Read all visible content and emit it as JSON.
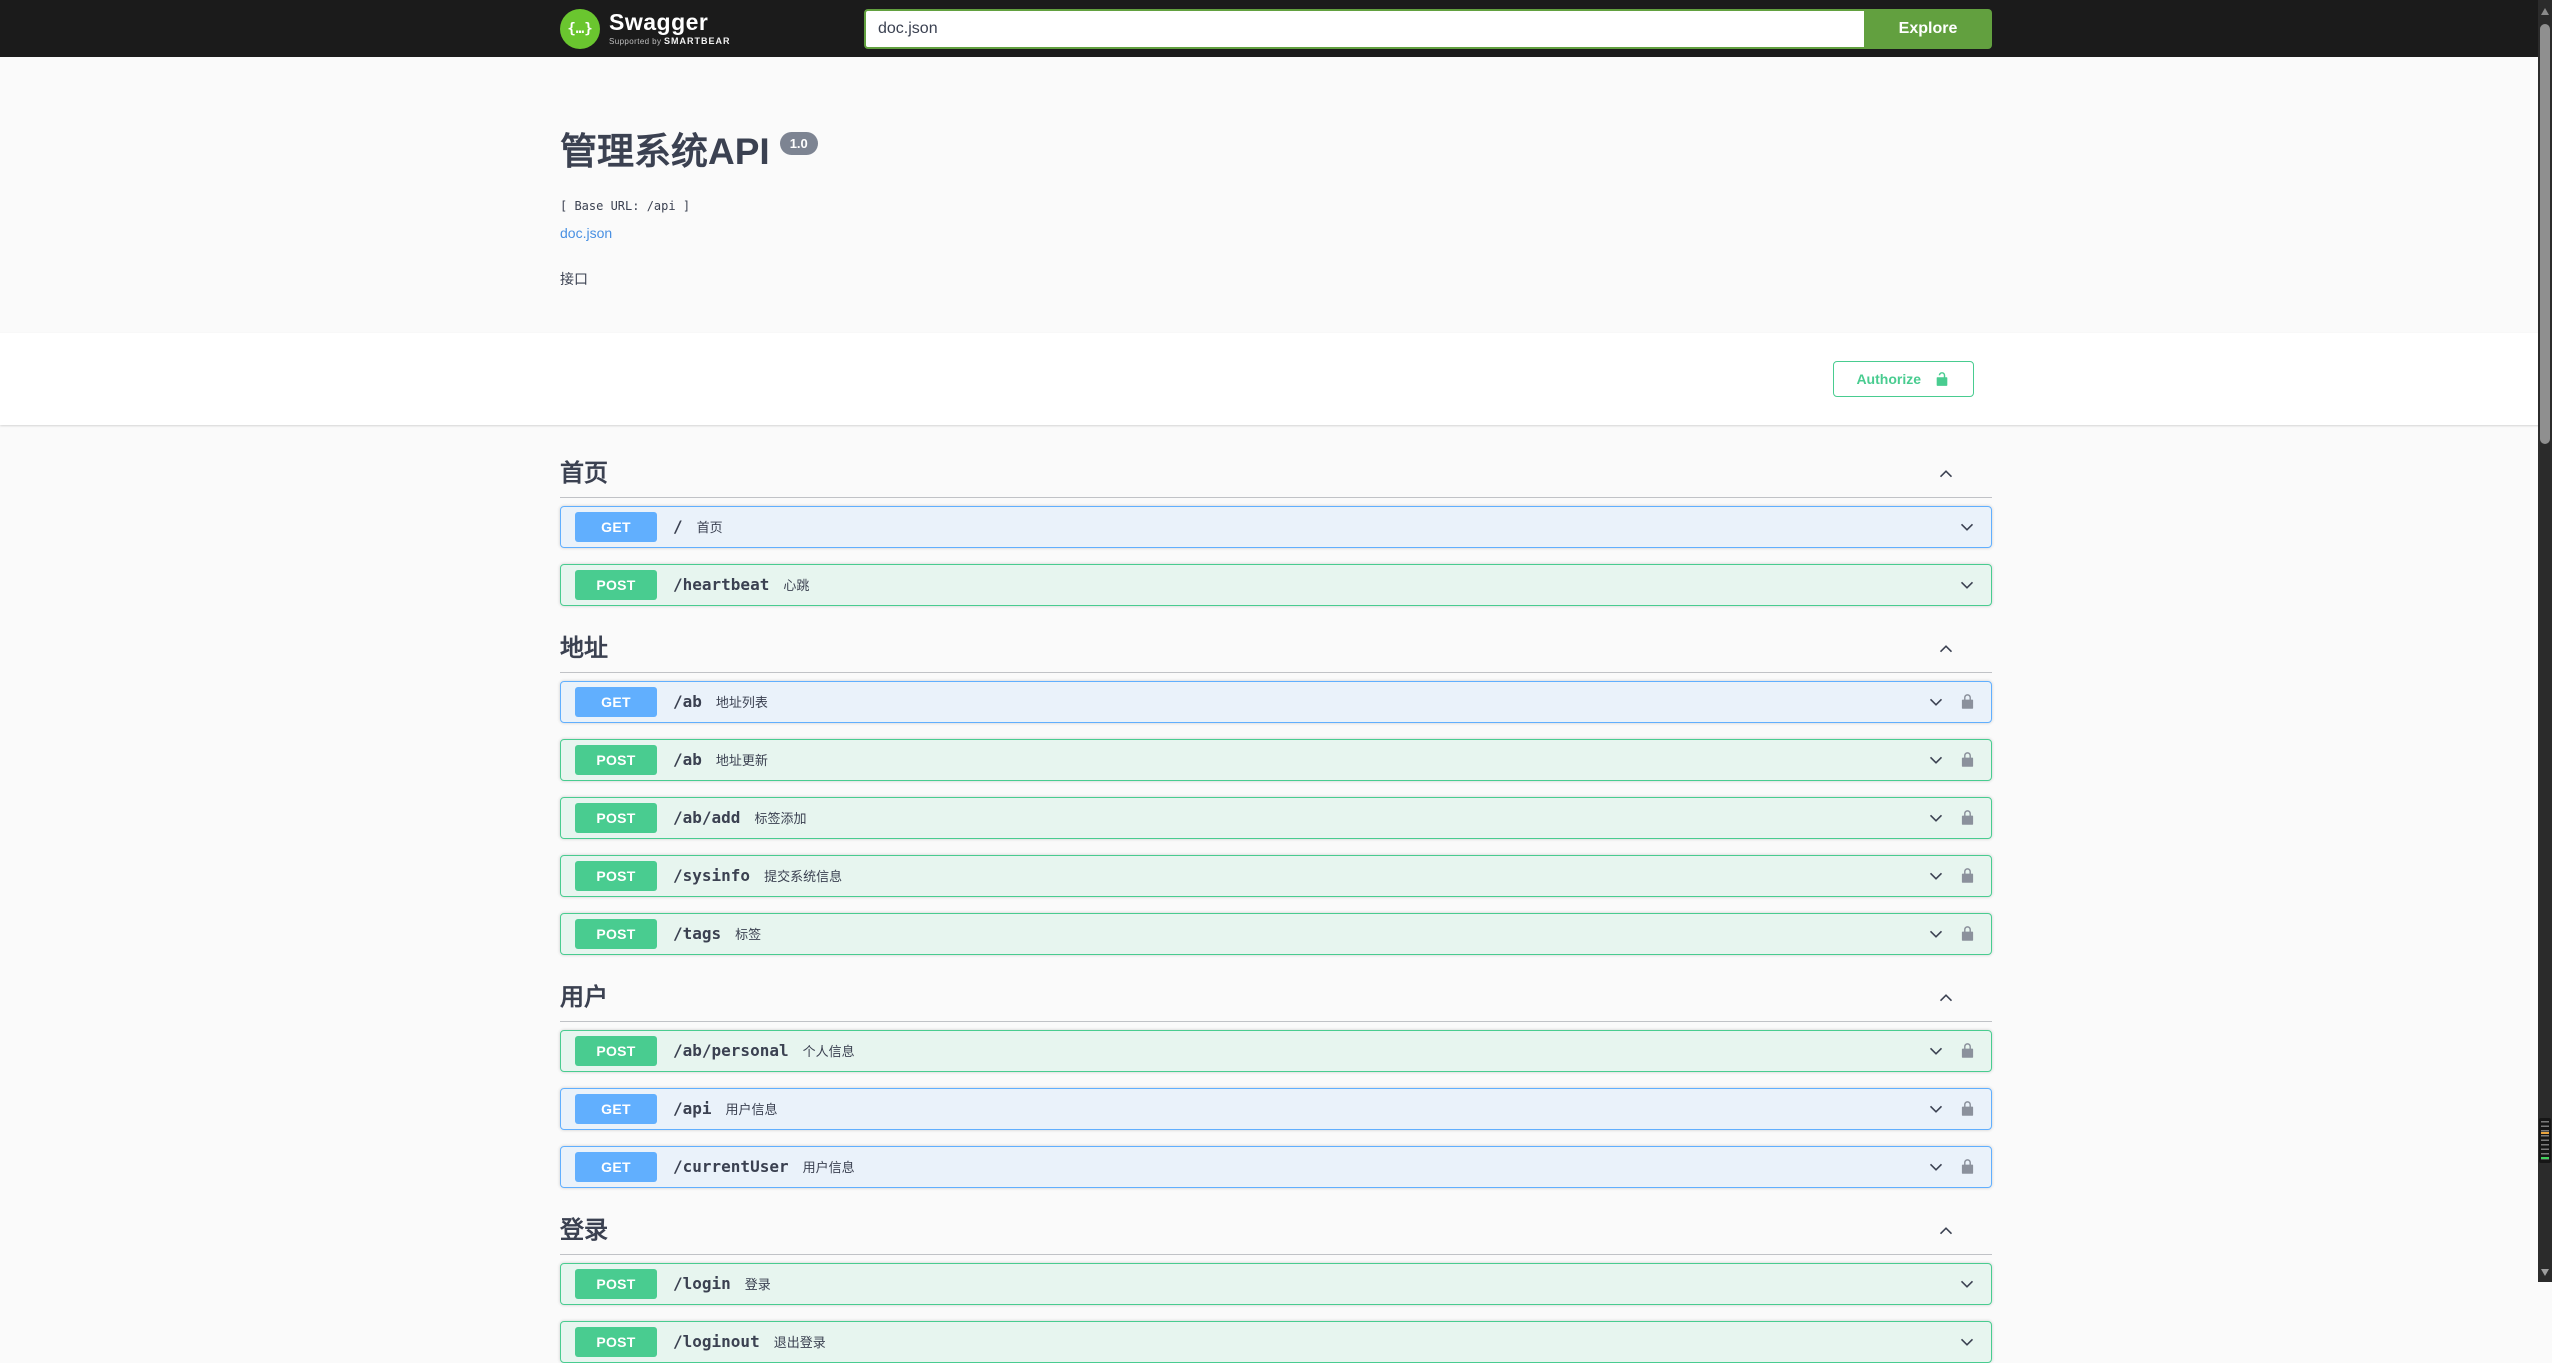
{
  "topbar": {
    "logo_text": "Swagger",
    "tagline_prefix": "Supported by",
    "tagline_brand": "SMARTBEAR",
    "search_value": "doc.json",
    "explore_label": "Explore"
  },
  "info": {
    "title": "管理系统API",
    "version_badge": "1.0",
    "base_url_line": "[ Base URL: /api ]",
    "spec_link": "doc.json",
    "description": "接口"
  },
  "auth": {
    "authorize_label": "Authorize"
  },
  "colors": {
    "topbar_bg": "#1b1b1b",
    "topbar_green": "#62a03f",
    "logo_green": "#6ac62f",
    "get_blue": "#61affe",
    "post_green": "#49cc90",
    "text": "#3b4151",
    "link_blue": "#4990e2",
    "version_badge_bg": "#7d8492",
    "lock_gray": "#8b919c",
    "scroll_marker_orange": "#e8a33d",
    "scroll_marker_green": "#43d05e"
  },
  "icons": [
    "swagger-logo",
    "search-input",
    "explore-button",
    "unlock-icon",
    "chevron-up-icon",
    "chevron-down-icon",
    "lock-icon",
    "scroll-up-icon",
    "scroll-down-icon"
  ],
  "sections": [
    {
      "name": "首页",
      "expanded": true,
      "operations": [
        {
          "method": "GET",
          "path": "/",
          "summary": "首页",
          "locked": false
        },
        {
          "method": "POST",
          "path": "/heartbeat",
          "summary": "心跳",
          "locked": false
        }
      ]
    },
    {
      "name": "地址",
      "expanded": true,
      "operations": [
        {
          "method": "GET",
          "path": "/ab",
          "summary": "地址列表",
          "locked": true
        },
        {
          "method": "POST",
          "path": "/ab",
          "summary": "地址更新",
          "locked": true
        },
        {
          "method": "POST",
          "path": "/ab/add",
          "summary": "标签添加",
          "locked": true
        },
        {
          "method": "POST",
          "path": "/sysinfo",
          "summary": "提交系统信息",
          "locked": true
        },
        {
          "method": "POST",
          "path": "/tags",
          "summary": "标签",
          "locked": true
        }
      ]
    },
    {
      "name": "用户",
      "expanded": true,
      "operations": [
        {
          "method": "POST",
          "path": "/ab/personal",
          "summary": "个人信息",
          "locked": true
        },
        {
          "method": "GET",
          "path": "/api",
          "summary": "用户信息",
          "locked": true
        },
        {
          "method": "GET",
          "path": "/currentUser",
          "summary": "用户信息",
          "locked": true
        }
      ]
    },
    {
      "name": "登录",
      "expanded": true,
      "operations": [
        {
          "method": "POST",
          "path": "/login",
          "summary": "登录",
          "locked": false
        },
        {
          "method": "POST",
          "path": "/loginout",
          "summary": "退出登录",
          "locked": false,
          "clipped": true
        }
      ]
    }
  ]
}
